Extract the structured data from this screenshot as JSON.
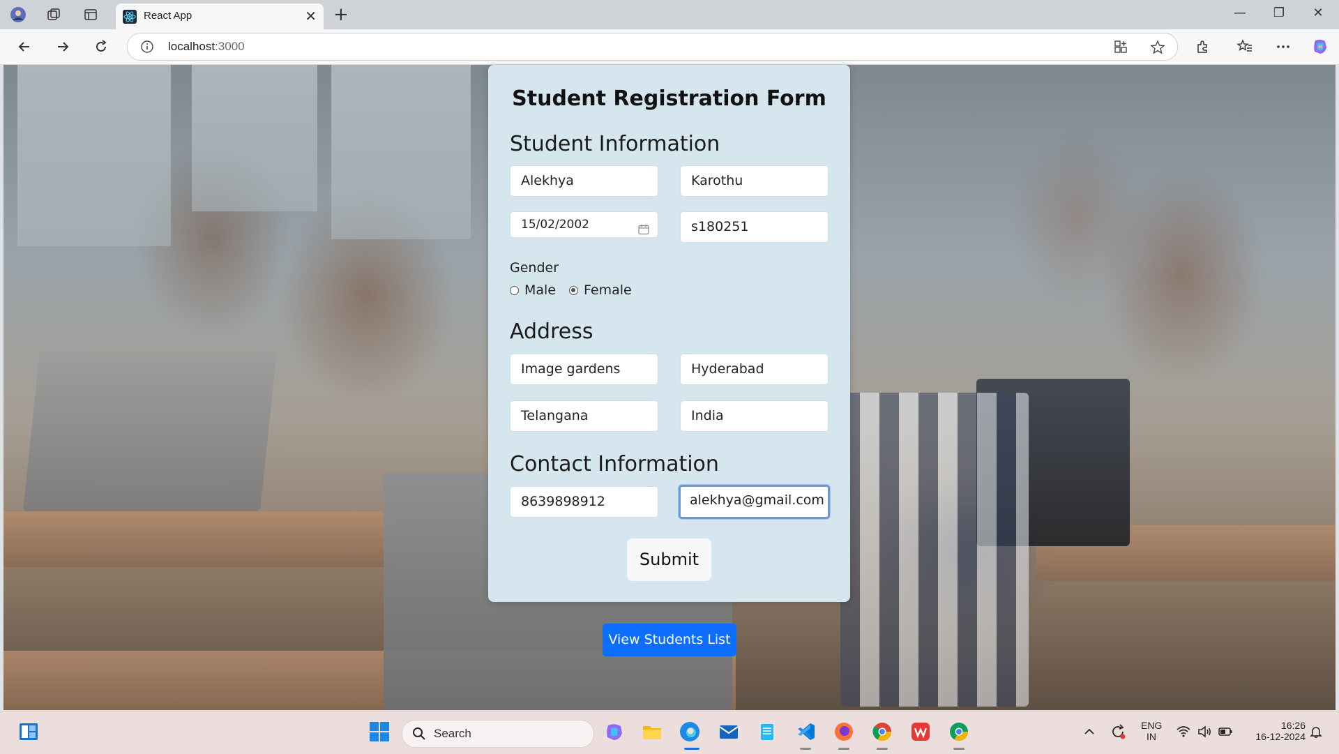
{
  "browser": {
    "tab_title": "React App",
    "url_host": "localhost",
    "url_port": ":3000"
  },
  "form": {
    "title": "Student Registration Form",
    "sections": {
      "student_info": "Student Information",
      "address": "Address",
      "contact": "Contact Information"
    },
    "fields": {
      "first_name": "Alekhya",
      "last_name": "Karothu",
      "dob": "15/02/2002",
      "student_id": "s180251",
      "street": "Image gardens",
      "city": "Hyderabad",
      "state": "Telangana",
      "country": "India",
      "phone": "8639898912",
      "email": "alekhya@gmail.com"
    },
    "gender_label": "Gender",
    "gender_options": [
      "Male",
      "Female"
    ],
    "gender_selected": "Female",
    "submit_label": "Submit"
  },
  "view_students_label": "View Students List",
  "taskbar": {
    "search_label": "Search",
    "lang_top": "ENG",
    "lang_bottom": "IN",
    "time": "16:26",
    "date": "16-12-2024"
  },
  "colors": {
    "card_bg": "#d5e6ee",
    "primary_button": "#0d6efd",
    "focus_border": "#6b98d9"
  },
  "icons": [
    "profile-icon",
    "collections-icon",
    "tab-actions-icon",
    "react-icon",
    "close-icon",
    "plus-icon",
    "minimize-icon",
    "restore-icon",
    "back-icon",
    "forward-icon",
    "refresh-icon",
    "info-icon",
    "app-available-icon",
    "favorite-star-icon",
    "extensions-icon",
    "favorites-icon",
    "more-icon",
    "copilot-icon",
    "calendar-icon",
    "widgets-icon",
    "windows-start-icon",
    "search-icon",
    "mail-icon",
    "notepad-icon",
    "vscode-icon",
    "firefox-icon",
    "chrome-icon",
    "wps-icon",
    "refresh-sync-icon",
    "wifi-icon",
    "volume-icon",
    "battery-icon",
    "bell-icon",
    "chevron-up-icon"
  ]
}
